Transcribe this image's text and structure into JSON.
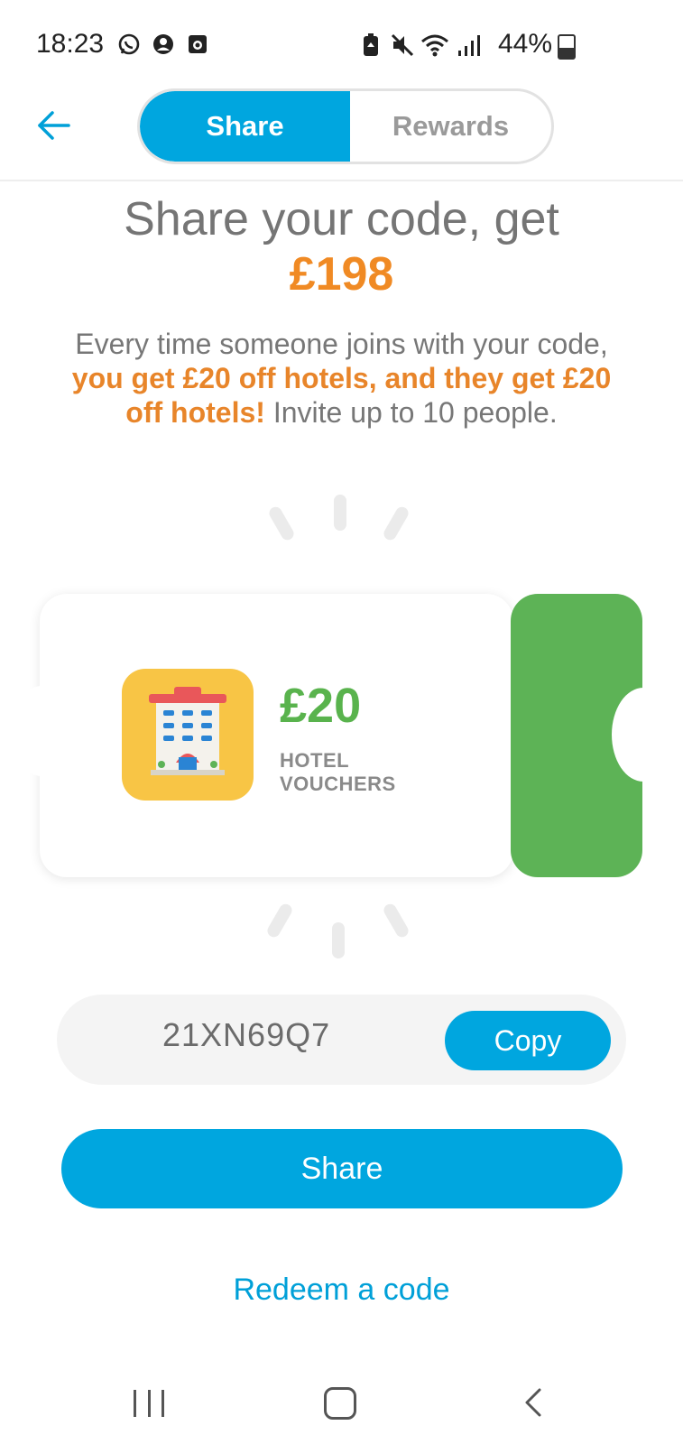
{
  "status_bar": {
    "time": "18:23",
    "battery_percent": "44%",
    "left_icons": [
      "whatsapp-icon",
      "account-icon",
      "screen-record-icon"
    ],
    "right_icons": [
      "battery-saver-icon",
      "mute-icon",
      "wifi-icon",
      "signal-icon",
      "battery-icon"
    ]
  },
  "header": {
    "tabs": [
      {
        "label": "Share",
        "selected": true
      },
      {
        "label": "Rewards",
        "selected": false
      }
    ]
  },
  "hero": {
    "title": "Share your code, get",
    "amount": "£198",
    "desc_part1": "Every time someone joins with your code, ",
    "desc_highlight": "you get £20 off hotels, and they get £20 off hotels!",
    "desc_part2": " Invite up to 10 people."
  },
  "voucher": {
    "amount": "£20",
    "label_line1": "HOTEL",
    "label_line2": "VOUCHERS",
    "icon": "hotel-icon"
  },
  "code": {
    "value": "21XN69Q7",
    "copy_label": "Copy"
  },
  "actions": {
    "share_label": "Share",
    "redeem_label": "Redeem a code"
  },
  "colors": {
    "primary": "#00a6df",
    "orange": "#f08a24",
    "green": "#5db356",
    "tile_yellow": "#f8c545"
  }
}
